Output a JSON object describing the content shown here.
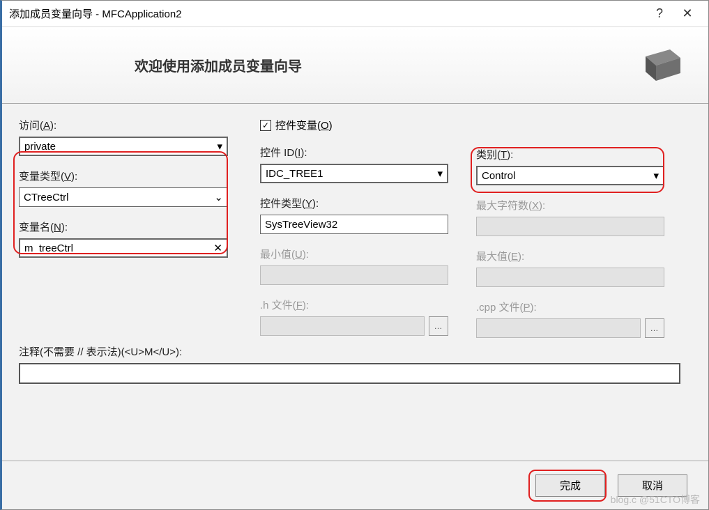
{
  "titlebar": {
    "title": "添加成员变量向导 - MFCApplication2"
  },
  "header": {
    "welcome": "欢迎使用添加成员变量向导"
  },
  "access": {
    "label_pre": "访问(",
    "hotkey": "A",
    "label_post": "):",
    "value": "private"
  },
  "controlVar": {
    "label_pre": "控件变量(",
    "hotkey": "O",
    "label_post": ")",
    "checked": true
  },
  "varType": {
    "label_pre": "变量类型(",
    "hotkey": "V",
    "label_post": "):",
    "value": "CTreeCtrl"
  },
  "varName": {
    "label_pre": "变量名(",
    "hotkey": "N",
    "label_post": "):",
    "value": "m_treeCtrl"
  },
  "controlId": {
    "label_pre": "控件 ID(",
    "hotkey": "I",
    "label_post": "):",
    "value": "IDC_TREE1"
  },
  "controlType": {
    "label_pre": "控件类型(",
    "hotkey": "Y",
    "label_post": "):",
    "value": "SysTreeView32"
  },
  "minVal": {
    "label_pre": "最小值(",
    "hotkey": "U",
    "label_post": "):"
  },
  "hFile": {
    "label_pre": ".h 文件(",
    "hotkey": "F",
    "label_post": "):"
  },
  "category": {
    "label_pre": "类别(",
    "hotkey": "T",
    "label_post": "):",
    "value": "Control"
  },
  "maxChars": {
    "label_pre": "最大字符数(",
    "hotkey": "X",
    "label_post": "):"
  },
  "maxVal": {
    "label_pre": "最大值(",
    "hotkey": "E",
    "label_post": "):"
  },
  "cppFile": {
    "label_pre": ".cpp 文件(",
    "hotkey": "P",
    "label_post": "):"
  },
  "comment": {
    "label": "注释(不需要 // 表示法)(<U>M</U>):"
  },
  "footer": {
    "finish": "完成",
    "cancel": "取消"
  },
  "watermark": "blog.c @51CTO博客"
}
